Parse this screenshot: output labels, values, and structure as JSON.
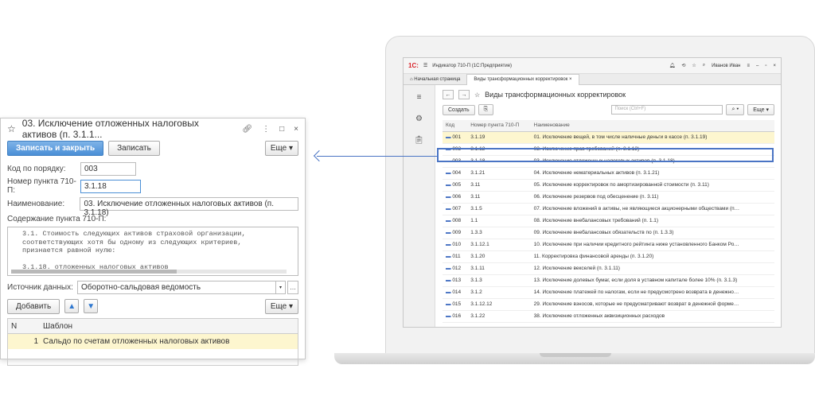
{
  "laptop": {
    "title": "Индикатор 710-П (1С:Предприятие)",
    "user": "Иванов Иван",
    "tabs": [
      "Начальная страница",
      "Виды трансформационных корректировок"
    ],
    "list_title": "Виды трансформационных корректировок",
    "create_label": "Создать",
    "search_placeholder": "Поиск (Ctrl+F)",
    "more_label": "Еще",
    "columns": [
      "Код",
      "Номер пункта 710-П",
      "Наименование"
    ],
    "rows": [
      {
        "code": "001",
        "num": "3.1.19",
        "name": "01. Исключение вещей, в том числе наличные деньги в кассе (п. 3.1.19)"
      },
      {
        "code": "002",
        "num": "3.1.12",
        "name": "02. Исключение прав требований (п. 3.1.12)"
      },
      {
        "code": "003",
        "num": "3.1.18",
        "name": "03. Исключение отложенных налоговых активов (п. 3.1.18)"
      },
      {
        "code": "004",
        "num": "3.1.21",
        "name": "04. Исключение нематериальных активов (п. 3.1.21)"
      },
      {
        "code": "005",
        "num": "3.11",
        "name": "05. Исключение корректировок по амортизированной стоимости (п. 3.11)"
      },
      {
        "code": "006",
        "num": "3.11",
        "name": "06. Исключение резервов под обесценение (п. 3.11)"
      },
      {
        "code": "007",
        "num": "3.1.5",
        "name": "07. Исключение вложений в активы, не являющиеся акционерными обществами (п…"
      },
      {
        "code": "008",
        "num": "1.1",
        "name": "08. Исключение внебалансовых требований (п. 1.1)"
      },
      {
        "code": "009",
        "num": "1.3.3",
        "name": "09. Исключение внебалансовых обязательств по (п. 1.3.3)"
      },
      {
        "code": "010",
        "num": "3.1.12.1",
        "name": "10. Исключение при наличии кредитного рейтинга ниже установленного Банком Ро…"
      },
      {
        "code": "011",
        "num": "3.1.20",
        "name": "11. Корректировка финансовой аренды (п. 3.1.20)"
      },
      {
        "code": "012",
        "num": "3.1.11",
        "name": "12. Исключение векселей (п. 3.1.11)"
      },
      {
        "code": "013",
        "num": "3.1.3",
        "name": "13. Исключение долевых бумаг, если доля в уставном капитале более 10% (п. 3.1.3)"
      },
      {
        "code": "014",
        "num": "3.1.2",
        "name": "14. Исключение платежей по налогам, если не предусмотрено возврата в денежно…"
      },
      {
        "code": "015",
        "num": "3.1.12.12",
        "name": "29. Исключение взносов, которые не предусматривают возврат в денежной форме…"
      },
      {
        "code": "016",
        "num": "3.1.22",
        "name": "38. Исключение отложенных аквизиционных расходов"
      }
    ]
  },
  "form": {
    "title": "03. Исключение отложенных налоговых активов (п. 3.1.1...",
    "save_close": "Записать и закрыть",
    "save": "Записать",
    "more": "Еще",
    "order_label": "Код по порядку:",
    "order_value": "003",
    "num_label": "Номер пункта 710-П:",
    "num_value": "3.1.18",
    "name_label": "Наименование:",
    "name_value": "03. Исключение отложенных налоговых активов (п. 3.1.18)",
    "content_label": "Содержание пункта 710-П:",
    "content_text": "3.1. Стоимость следующих активов страховой организации,\nсоответствующих хотя бы одному из следующих критериев,\nпризнается равной нулю:\n\n3.1.18. отложенных налоговых активов",
    "source_label": "Источник данных:",
    "source_value": "Оборотно-сальдовая ведомость",
    "add": "Добавить",
    "more2": "Еще",
    "grid_col_n": "N",
    "grid_col_tpl": "Шаблон",
    "grid_row_n": "1",
    "grid_row_tpl": "Сальдо по счетам отложенных налоговых активов"
  }
}
